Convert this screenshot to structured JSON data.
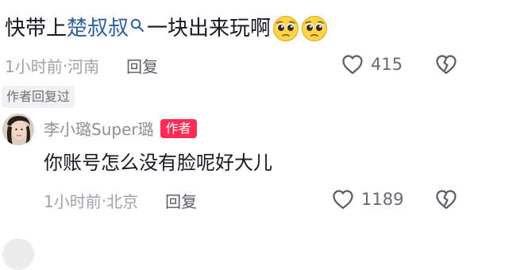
{
  "top_comment": {
    "text_prefix": "快带上",
    "mention_name": "楚叔叔",
    "text_suffix": "一块出来玩啊",
    "emoji_name": "pleading-face",
    "meta_time": "1小时前",
    "meta_sep": " · ",
    "meta_location": "河南",
    "reply_label": "回复",
    "like_count": "415"
  },
  "author_replied_tag": "作者回复过",
  "reply": {
    "username": "李小璐Super璐",
    "author_badge": "作者",
    "text": "你账号怎么没有脸呢好大儿",
    "meta_time": "1小时前",
    "meta_sep": " · ",
    "meta_location": "北京",
    "reply_label": "回复",
    "like_count": "1189"
  },
  "icons": {
    "like": "heart-outline-icon",
    "dislike": "broken-heart-icon",
    "mention": "search-icon"
  },
  "colors": {
    "mention": "#2f5e9e",
    "author_badge": "#fe2c55",
    "meta_text": "#a0a2aa",
    "main_text": "#161823"
  }
}
